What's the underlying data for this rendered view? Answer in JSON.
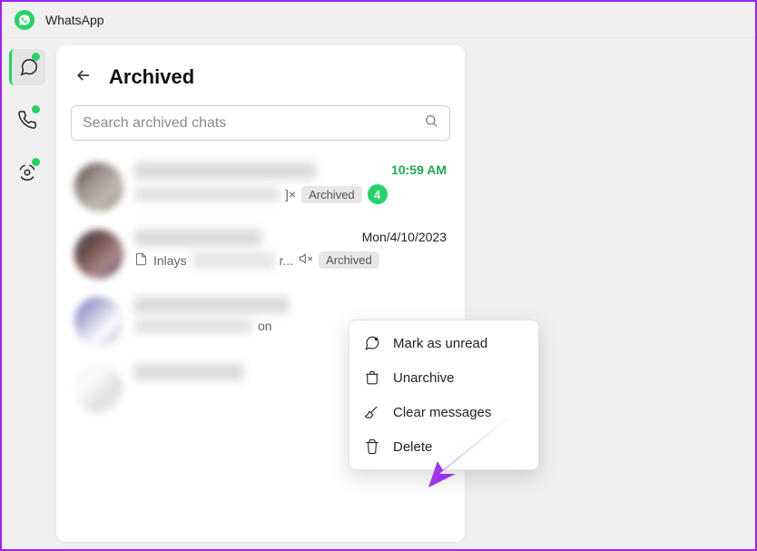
{
  "app": {
    "title": "WhatsApp"
  },
  "panel": {
    "title": "Archived"
  },
  "search": {
    "placeholder": "Search archived chats"
  },
  "chats": [
    {
      "time": "10:59 AM",
      "time_style": "green",
      "archived_label": "Archived",
      "unread_count": "4",
      "subtext_suffix": "]×"
    },
    {
      "time": "Mon/4/10/2023",
      "doc_label": "Inlays",
      "archived_label": "Archived",
      "subtext_suffix": "r..."
    },
    {
      "subtext_suffix": "on"
    },
    {}
  ],
  "context_menu": {
    "mark_unread": "Mark as unread",
    "unarchive": "Unarchive",
    "clear": "Clear messages",
    "delete": "Delete"
  }
}
